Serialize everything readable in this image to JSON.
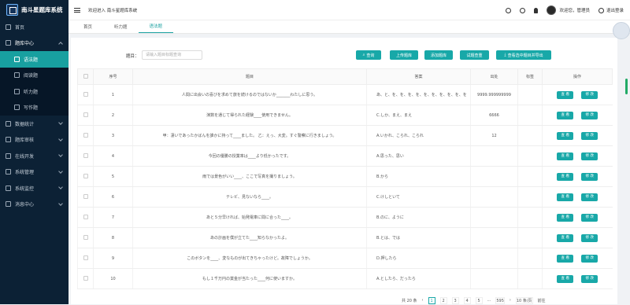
{
  "app": {
    "title": "南斗星题库系统"
  },
  "sidebar": {
    "items": [
      {
        "label": "首页",
        "icon": "home-icon"
      },
      {
        "label": "题库中心",
        "icon": "database-icon",
        "expanded": true
      },
      {
        "label": "数据统计",
        "icon": "chart-icon"
      },
      {
        "label": "题库审核",
        "icon": "audit-icon"
      },
      {
        "label": "在线开发",
        "icon": "code-icon"
      },
      {
        "label": "系统管理",
        "icon": "settings-icon"
      },
      {
        "label": "系统监控",
        "icon": "monitor-icon"
      },
      {
        "label": "消息中心",
        "icon": "message-icon"
      }
    ],
    "sub": [
      {
        "label": "语法题",
        "icon": "doc-icon",
        "active": true
      },
      {
        "label": "阅读题",
        "icon": "book-icon"
      },
      {
        "label": "听力题",
        "icon": "headphone-icon"
      },
      {
        "label": "写作题",
        "icon": "edit-icon"
      }
    ]
  },
  "topbar": {
    "welcome": "欢迎进入 南斗星题库系统",
    "user": "欢迎您，管理员",
    "logout": "退出登录"
  },
  "tabs": [
    {
      "label": "首页"
    },
    {
      "label": "听力题"
    },
    {
      "label": "语法题",
      "active": true
    }
  ],
  "search": {
    "label": "题目：",
    "placeholder": "请输入题目标题查询",
    "buttons": [
      "查询",
      "上传题库",
      "添加题库",
      "试题查重",
      "查看选中题目并导出"
    ]
  },
  "table": {
    "headers": [
      "序号",
      "题目",
      "答案",
      "出处",
      "标签",
      "操作"
    ],
    "actions": [
      "查 看",
      "修 改"
    ],
    "rows": [
      {
        "no": "1",
        "q": "人間に出会いの喜びを求めて旅を続けるのではないか_______わたしに思う。",
        "a": "あ、と、を、を、を、を、を、を、を、を、を、を",
        "s": "9999.999999999"
      },
      {
        "no": "2",
        "q": "演数を通じて得られた経験____使用できません。",
        "a": "C.しか、まえ、まえ",
        "s": "6666"
      },
      {
        "no": "3",
        "q": "甲：凄いであったかばんを誰かに持って____ました。 乙：えっ、大変。すぐ警察に行きましょう。",
        "a": "A.いかれ、こられ、こられ",
        "s": "12"
      },
      {
        "no": "4",
        "q": "今回の優勝の授業率は____より低かったです。",
        "a": "A.思った、思い",
        "s": ""
      },
      {
        "no": "5",
        "q": "雨では景色がいい____、ここで写真を撮りましょう。",
        "a": "B.から",
        "s": ""
      },
      {
        "no": "6",
        "q": "テレビ、見ないなら____。",
        "a": "C.けしといて",
        "s": ""
      },
      {
        "no": "7",
        "q": "あと５分早ければ、始発電車に間に合った____。",
        "a": "B.のに、ように",
        "s": ""
      },
      {
        "no": "8",
        "q": "あの計画を僕が立てた____知らなかったよ。",
        "a": "B.とは、では",
        "s": ""
      },
      {
        "no": "9",
        "q": "このボタンを____、変なものが出てきちゃったけど。故障でしょうか。",
        "a": "D.押したら",
        "s": ""
      },
      {
        "no": "10",
        "q": "もし１千万円の賞金が当たった____何に使いますか。",
        "a": "A.としたら、だったら",
        "s": ""
      }
    ]
  },
  "pager": {
    "total": "共 20 条",
    "pages": [
      "1",
      "2",
      "3",
      "4",
      "5",
      "...",
      "595"
    ],
    "page_size": "10 条/页",
    "goto": "前往"
  },
  "colors": {
    "accent": "#18a8a8",
    "sidebar": "#0c2135"
  }
}
